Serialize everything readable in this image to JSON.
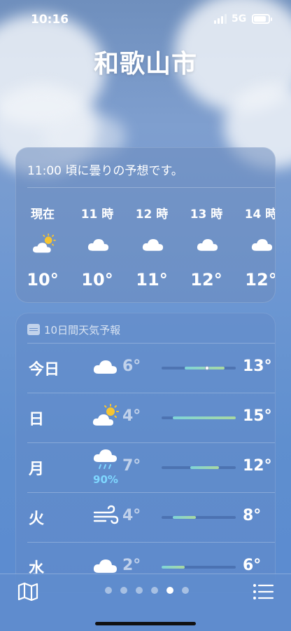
{
  "status": {
    "time": "10:16",
    "network": "5G"
  },
  "city": "和歌山市",
  "hourly": {
    "summary": "11:00 頃に曇りの予想です。",
    "items": [
      {
        "label": "現在",
        "icon": "partly-sunny-icon",
        "temp": "10°"
      },
      {
        "label": "11 時",
        "icon": "cloud-icon",
        "temp": "10°"
      },
      {
        "label": "12 時",
        "icon": "cloud-icon",
        "temp": "11°"
      },
      {
        "label": "13 時",
        "icon": "cloud-icon",
        "temp": "12°"
      },
      {
        "label": "14 時",
        "icon": "cloud-icon",
        "temp": "12°"
      }
    ]
  },
  "daily": {
    "header": "10日間天気予報",
    "range_min": 2,
    "range_max": 15,
    "current_temp": 10,
    "rows": [
      {
        "day": "今日",
        "icon": "cloud-icon",
        "precip": "",
        "lo": "6°",
        "hi": "13°",
        "lo_val": 6,
        "hi_val": 13,
        "current": true
      },
      {
        "day": "日",
        "icon": "partly-sunny-icon",
        "precip": "",
        "lo": "4°",
        "hi": "15°",
        "lo_val": 4,
        "hi_val": 15,
        "current": false
      },
      {
        "day": "月",
        "icon": "rain-cloud-icon",
        "precip": "90%",
        "lo": "7°",
        "hi": "12°",
        "lo_val": 7,
        "hi_val": 12,
        "current": false
      },
      {
        "day": "火",
        "icon": "wind-icon",
        "precip": "",
        "lo": "4°",
        "hi": "8°",
        "lo_val": 4,
        "hi_val": 8,
        "current": false
      },
      {
        "day": "水",
        "icon": "cloud-icon",
        "precip": "",
        "lo": "2°",
        "hi": "6°",
        "lo_val": 2,
        "hi_val": 6,
        "current": false
      }
    ]
  },
  "pager": {
    "count": 6,
    "active_index": 4
  },
  "colors": {
    "accent_precip": "#7fd7ff",
    "bar_start": "#7fd4d8",
    "bar_end": "#a9d9a0"
  }
}
